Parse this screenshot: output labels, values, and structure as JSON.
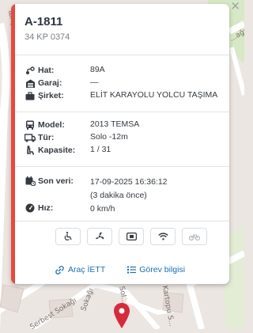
{
  "map": {
    "street_labels": [
      "İbriş...",
      "...ağı",
      "Serbest Sokağı",
      "Sokağı",
      "Kartopu S...",
      "Sol..."
    ],
    "close_symbol": "×"
  },
  "popup": {
    "plate": "A-1811",
    "license_plate": "34 KP 0374",
    "rows": {
      "line": {
        "label": "Hat:",
        "value": "89A",
        "icon": "route-icon"
      },
      "garage": {
        "label": "Garaj:",
        "value": "—",
        "icon": "garage-icon"
      },
      "company": {
        "label": "Şirket:",
        "value": "ELİT KARAYOLU YOLCU TAŞIMA",
        "icon": "briefcase-icon"
      },
      "model": {
        "label": "Model:",
        "value": "2013 TEMSA",
        "icon": "bus-icon"
      },
      "type": {
        "label": "Tür:",
        "value": "Solo -12m",
        "icon": "truck-icon"
      },
      "capacity": {
        "label": "Kapasite:",
        "value": "1 / 31",
        "icon": "people-icon"
      },
      "last_data": {
        "label": "Son veri:",
        "value": "17-09-2025 16:36:12",
        "sub": "(3 dakika önce)",
        "icon": "calendar-icon"
      },
      "speed": {
        "label": "Hız:",
        "value": "0 km/h",
        "icon": "speedometer-icon"
      }
    },
    "features": [
      "wheelchair-icon",
      "fan-icon",
      "card-reader-icon",
      "wifi-icon",
      "bicycle-icon"
    ],
    "links": {
      "vehicle": "Araç İETT",
      "task": "Görev bilgisi"
    }
  },
  "colors": {
    "accent": "#e74a3b",
    "link": "#1a6fb3",
    "pin": "#d62b3b"
  }
}
